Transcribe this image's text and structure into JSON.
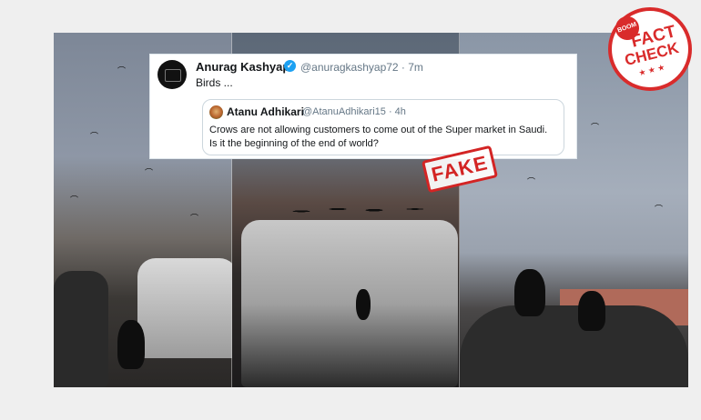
{
  "tweet": {
    "author_name": "Anurag Kashyap",
    "verified_glyph": "✓",
    "handle_time": "@anuragkashyap72 · 7m",
    "text": "Birds ...",
    "quote": {
      "author_name": "Atanu Adhikari",
      "handle_time": "@AtanuAdhikari15 · 4h",
      "text": "Crows are not allowing customers to come out of the Super market in Saudi. Is it the beginning of the end of world?"
    }
  },
  "fake_stamp": {
    "label": "FAKE",
    "color": "#d32424"
  },
  "fact_check_badge": {
    "boom": "BOOM",
    "fact": "FACT",
    "check": "CHECK",
    "stars": "★ ★ ★",
    "color": "#d92b2b"
  },
  "colors": {
    "background": "#efefef",
    "tweet_border": "#e1e8ed",
    "verified_blue": "#1da1f2",
    "handle_gray": "#657786"
  }
}
